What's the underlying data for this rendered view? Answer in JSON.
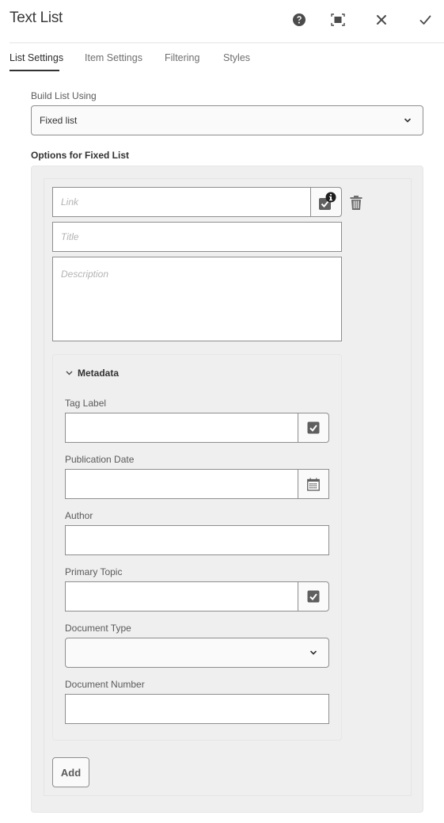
{
  "header": {
    "title": "Text List",
    "actions": [
      {
        "name": "help",
        "icon": "help-icon"
      },
      {
        "name": "fullscreen",
        "icon": "fullscreen-icon"
      },
      {
        "name": "cancel",
        "icon": "close-icon"
      },
      {
        "name": "done",
        "icon": "checkmark-icon"
      }
    ]
  },
  "tabs": [
    {
      "label": "List Settings",
      "active": true
    },
    {
      "label": "Item Settings",
      "active": false
    },
    {
      "label": "Filtering",
      "active": false
    },
    {
      "label": "Styles",
      "active": false
    }
  ],
  "build_list": {
    "label": "Build List Using",
    "value": "Fixed list"
  },
  "options": {
    "label": "Options for Fixed List",
    "item": {
      "link_placeholder": "Link",
      "title_placeholder": "Title",
      "description_placeholder": "Description",
      "metadata": {
        "toggle_label": "Metadata",
        "expanded": true,
        "fields": {
          "tag_label": {
            "label": "Tag Label",
            "value": ""
          },
          "publication_date": {
            "label": "Publication Date",
            "value": ""
          },
          "author": {
            "label": "Author",
            "value": ""
          },
          "primary_topic": {
            "label": "Primary Topic",
            "value": ""
          },
          "document_type": {
            "label": "Document Type",
            "value": ""
          },
          "document_number": {
            "label": "Document Number",
            "value": ""
          }
        }
      }
    },
    "add_label": "Add"
  },
  "colors": {
    "panel_bg": "#efefef",
    "border": "#8e8e8e",
    "text_dark": "#323232",
    "placeholder": "#b3b3b3"
  }
}
